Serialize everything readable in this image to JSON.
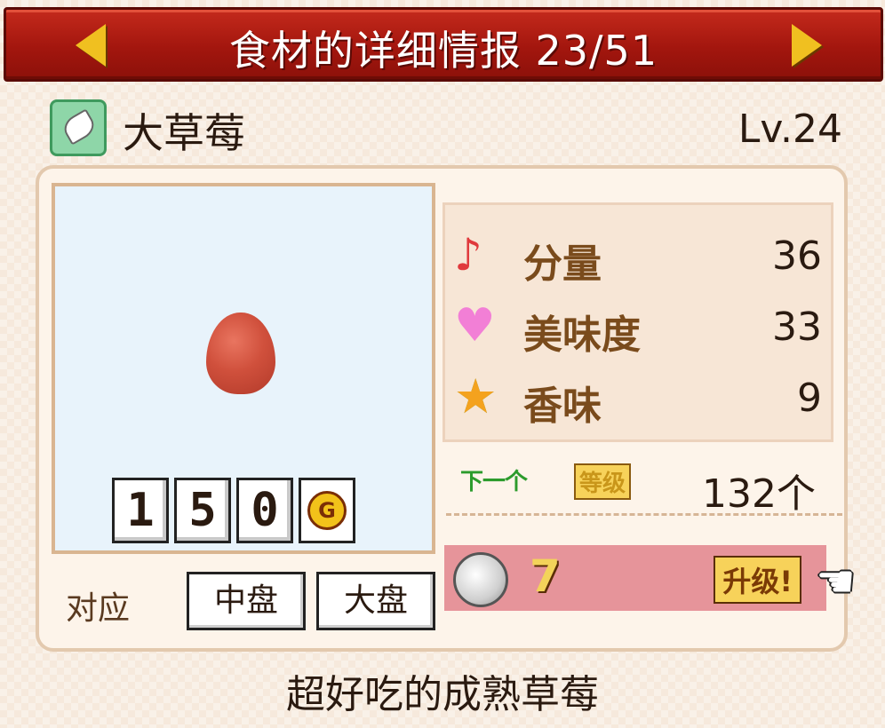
{
  "header": {
    "title": "食材的详细情报 23/51",
    "prev_label": "◀",
    "next_label": "▶"
  },
  "item": {
    "icon": "leaf-icon",
    "name": "大草莓",
    "level": "Lv.24",
    "description": "超好吃的成熟草莓"
  },
  "price": {
    "digits": [
      "1",
      "5",
      "0"
    ],
    "currency": "G"
  },
  "compat": {
    "label": "对应",
    "plates": [
      "中盘",
      "大盘"
    ]
  },
  "stats": [
    {
      "icon": "music-note-icon",
      "label": "分量",
      "value": "36"
    },
    {
      "icon": "heart-icon",
      "label": "美味度",
      "value": "33"
    },
    {
      "icon": "star-icon",
      "label": "香味",
      "value": "9"
    }
  ],
  "next_level": {
    "tag_a": "下一个",
    "tag_b": "等级",
    "value": "132个"
  },
  "upgrade": {
    "coin_count": "7",
    "button_label": "升级!"
  },
  "colors": {
    "title_bar": "#a3160e",
    "upgrade_bar": "#e6949a",
    "stat_label": "#7a4b1c"
  }
}
